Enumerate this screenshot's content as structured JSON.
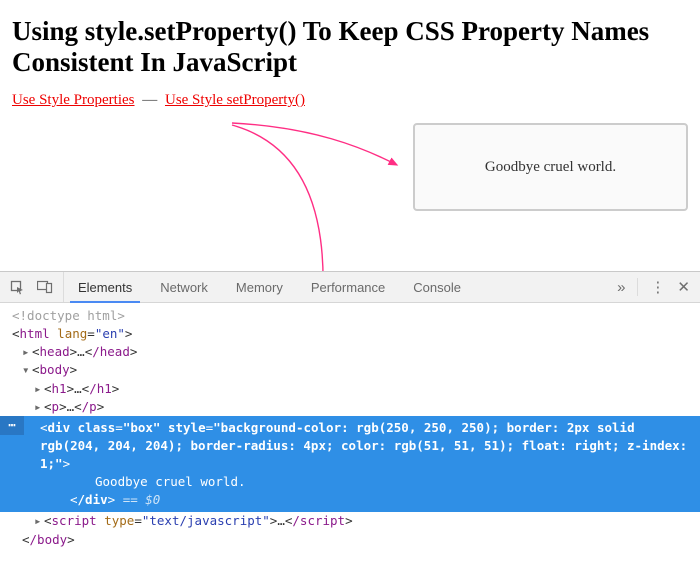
{
  "page": {
    "heading": "Using style.setProperty() To Keep CSS Property Names Consistent In JavaScript",
    "links": {
      "use_properties": "Use Style Properties",
      "separator": "—",
      "use_setproperty": "Use Style setProperty()"
    },
    "box_text": "Goodbye cruel world."
  },
  "devtools": {
    "tabs": {
      "elements": "Elements",
      "network": "Network",
      "memory": "Memory",
      "performance": "Performance",
      "console": "Console"
    },
    "more": "»",
    "kebab": "⋮",
    "close": "✕",
    "dom": {
      "doctype": "<!doctype html>",
      "html_open": "html",
      "html_lang_attr": "lang",
      "html_lang_val": "\"en\"",
      "head_open": "head",
      "head_ell": "…",
      "head_close": "/head",
      "body_open": "body",
      "h1_open": "h1",
      "h1_ell": "…",
      "h1_close": "/h1",
      "p_open": "p",
      "p_ell": "…",
      "p_close": "/p",
      "selected_ell": "⋯",
      "selected_open": "div",
      "selected_class_attr": "class",
      "selected_class_val": "\"box\"",
      "selected_style_attr": "style",
      "selected_style_val": "\"background-color: rgb(250, 250, 250); border: 2px solid rgb(204, 204, 204); border-radius: 4px; color: rgb(51, 51, 51); float: right; z-index: 1;\"",
      "selected_text": "Goodbye cruel world.",
      "selected_close": "/div",
      "eq0": " == $0",
      "script_open": "script",
      "script_type_attr": "type",
      "script_type_val": "\"text/javascript\"",
      "script_ell": "…",
      "script_close": "/script",
      "body_close": "/body"
    }
  }
}
